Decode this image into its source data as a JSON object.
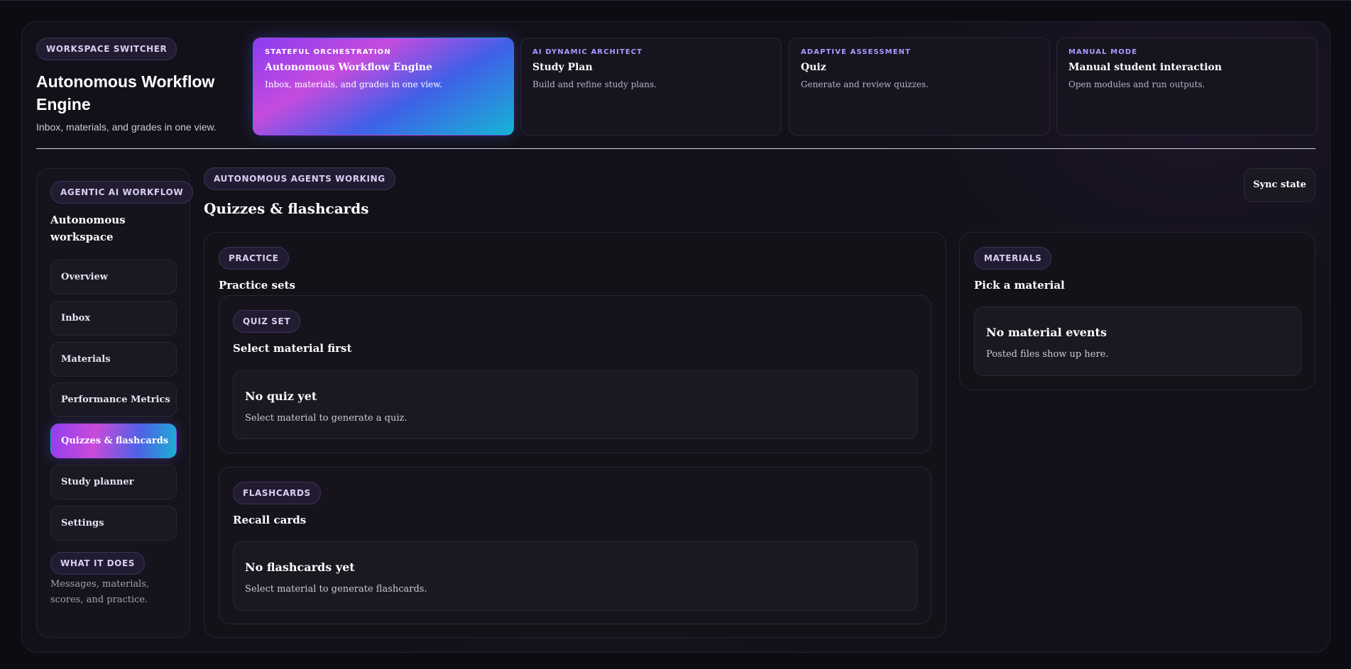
{
  "workspace_switcher": {
    "label": "WORKSPACE SWITCHER",
    "title": "Autonomous Workflow Engine",
    "subtitle": "Inbox, materials, and grades in one view."
  },
  "modes": [
    {
      "eyebrow": "STATEFUL ORCHESTRATION",
      "title": "Autonomous Workflow Engine",
      "desc": "Inbox, materials, and grades in one view.",
      "active": true
    },
    {
      "eyebrow": "AI DYNAMIC ARCHITECT",
      "title": "Study Plan",
      "desc": "Build and refine study plans.",
      "active": false
    },
    {
      "eyebrow": "ADAPTIVE ASSESSMENT",
      "title": "Quiz",
      "desc": "Generate and review quizzes.",
      "active": false
    },
    {
      "eyebrow": "MANUAL MODE",
      "title": "Manual student interaction",
      "desc": "Open modules and run outputs.",
      "active": false
    }
  ],
  "sidebar": {
    "badge": "AGENTIC AI WORKFLOW",
    "title": "Autonomous workspace",
    "items": [
      {
        "label": "Overview"
      },
      {
        "label": "Inbox"
      },
      {
        "label": "Materials"
      },
      {
        "label": "Performance Metrics"
      },
      {
        "label": "Quizzes & flashcards",
        "active": true
      },
      {
        "label": "Study planner"
      },
      {
        "label": "Settings"
      }
    ],
    "footer_badge": "WHAT IT DOES",
    "footer_text": "Messages, materials, scores, and practice."
  },
  "main": {
    "status_badge": "AUTONOMOUS AGENTS WORKING",
    "title": "Quizzes & flashcards",
    "sync_label": "Sync state",
    "practice": {
      "badge": "PRACTICE",
      "title": "Practice sets",
      "quiz": {
        "badge": "QUIZ SET",
        "title": "Select material first",
        "empty_title": "No quiz yet",
        "empty_desc": "Select material to generate a quiz."
      },
      "flashcards": {
        "badge": "FLASHCARDS",
        "title": "Recall cards",
        "empty_title": "No flashcards yet",
        "empty_desc": "Select material to generate flashcards."
      }
    },
    "materials": {
      "badge": "MATERIALS",
      "title": "Pick a material",
      "empty_title": "No material events",
      "empty_desc": "Posted files show up here."
    }
  },
  "colors": {
    "background": "#0d0c12",
    "accent_gradient": [
      "#8a3cf0",
      "#c54bde",
      "#3f60e8",
      "#16b4d4"
    ],
    "eyebrow": "#a79cff"
  }
}
